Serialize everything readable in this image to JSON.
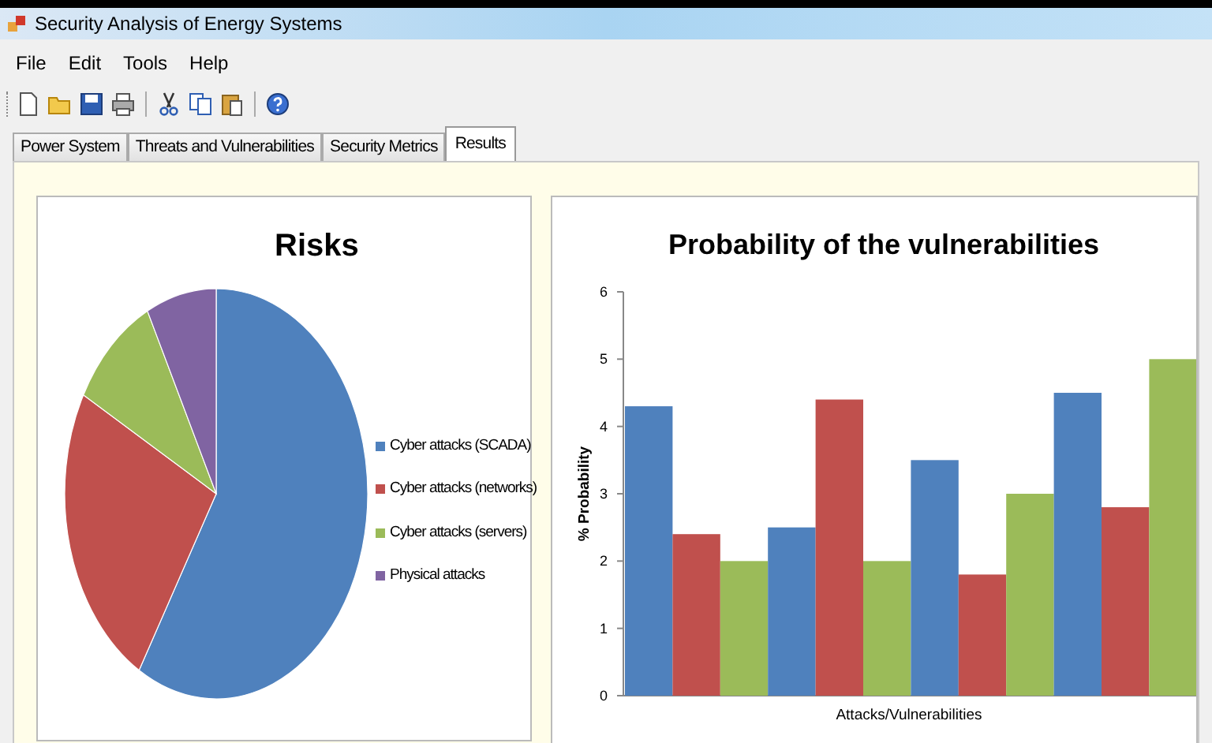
{
  "window": {
    "title": "Security Analysis of Energy Systems"
  },
  "menu": [
    "File",
    "Edit",
    "Tools",
    "Help"
  ],
  "toolbar": [
    {
      "kind": "new"
    },
    {
      "kind": "open"
    },
    {
      "kind": "save"
    },
    {
      "kind": "print"
    },
    {
      "kind": "separator"
    },
    {
      "kind": "cut"
    },
    {
      "kind": "copy"
    },
    {
      "kind": "paste"
    },
    {
      "kind": "separator"
    },
    {
      "kind": "help"
    }
  ],
  "tabs": [
    {
      "label": "Power System",
      "selected": false
    },
    {
      "label": "Threats and Vulnerabilities",
      "selected": false
    },
    {
      "label": "Security Metrics",
      "selected": false
    },
    {
      "label": "Results",
      "selected": true
    }
  ],
  "risks_chart": {
    "title": "Risks",
    "legend": [
      {
        "label": "Cyber attacks (SCADA)",
        "color": "#4f81bd"
      },
      {
        "label": "Cyber attacks (networks)",
        "color": "#c0504d"
      },
      {
        "label": "Cyber attacks (servers)",
        "color": "#9bbb59"
      },
      {
        "label": "Physical attacks",
        "color": "#8064a2"
      }
    ]
  },
  "probability_chart": {
    "chart_data": {
      "type": "bar",
      "title": "Probability of the vulnerabilities",
      "xlabel": "Attacks/Vulnerabilities",
      "ylabel": "% Probability",
      "categories": [
        null,
        null,
        null,
        null
      ],
      "series": [
        {
          "color": "#4f81bd",
          "values": [
            4.3,
            2.5,
            3.5,
            4.5
          ]
        },
        {
          "color": "#c0504d",
          "values": [
            2.4,
            4.4,
            1.8,
            2.8
          ]
        },
        {
          "color": "#9bbb59",
          "values": [
            2.0,
            2.0,
            3.0,
            5.0
          ]
        }
      ],
      "ylim": [
        0,
        6
      ],
      "yticks": [
        0,
        1,
        2,
        3,
        4,
        5,
        6
      ]
    }
  }
}
